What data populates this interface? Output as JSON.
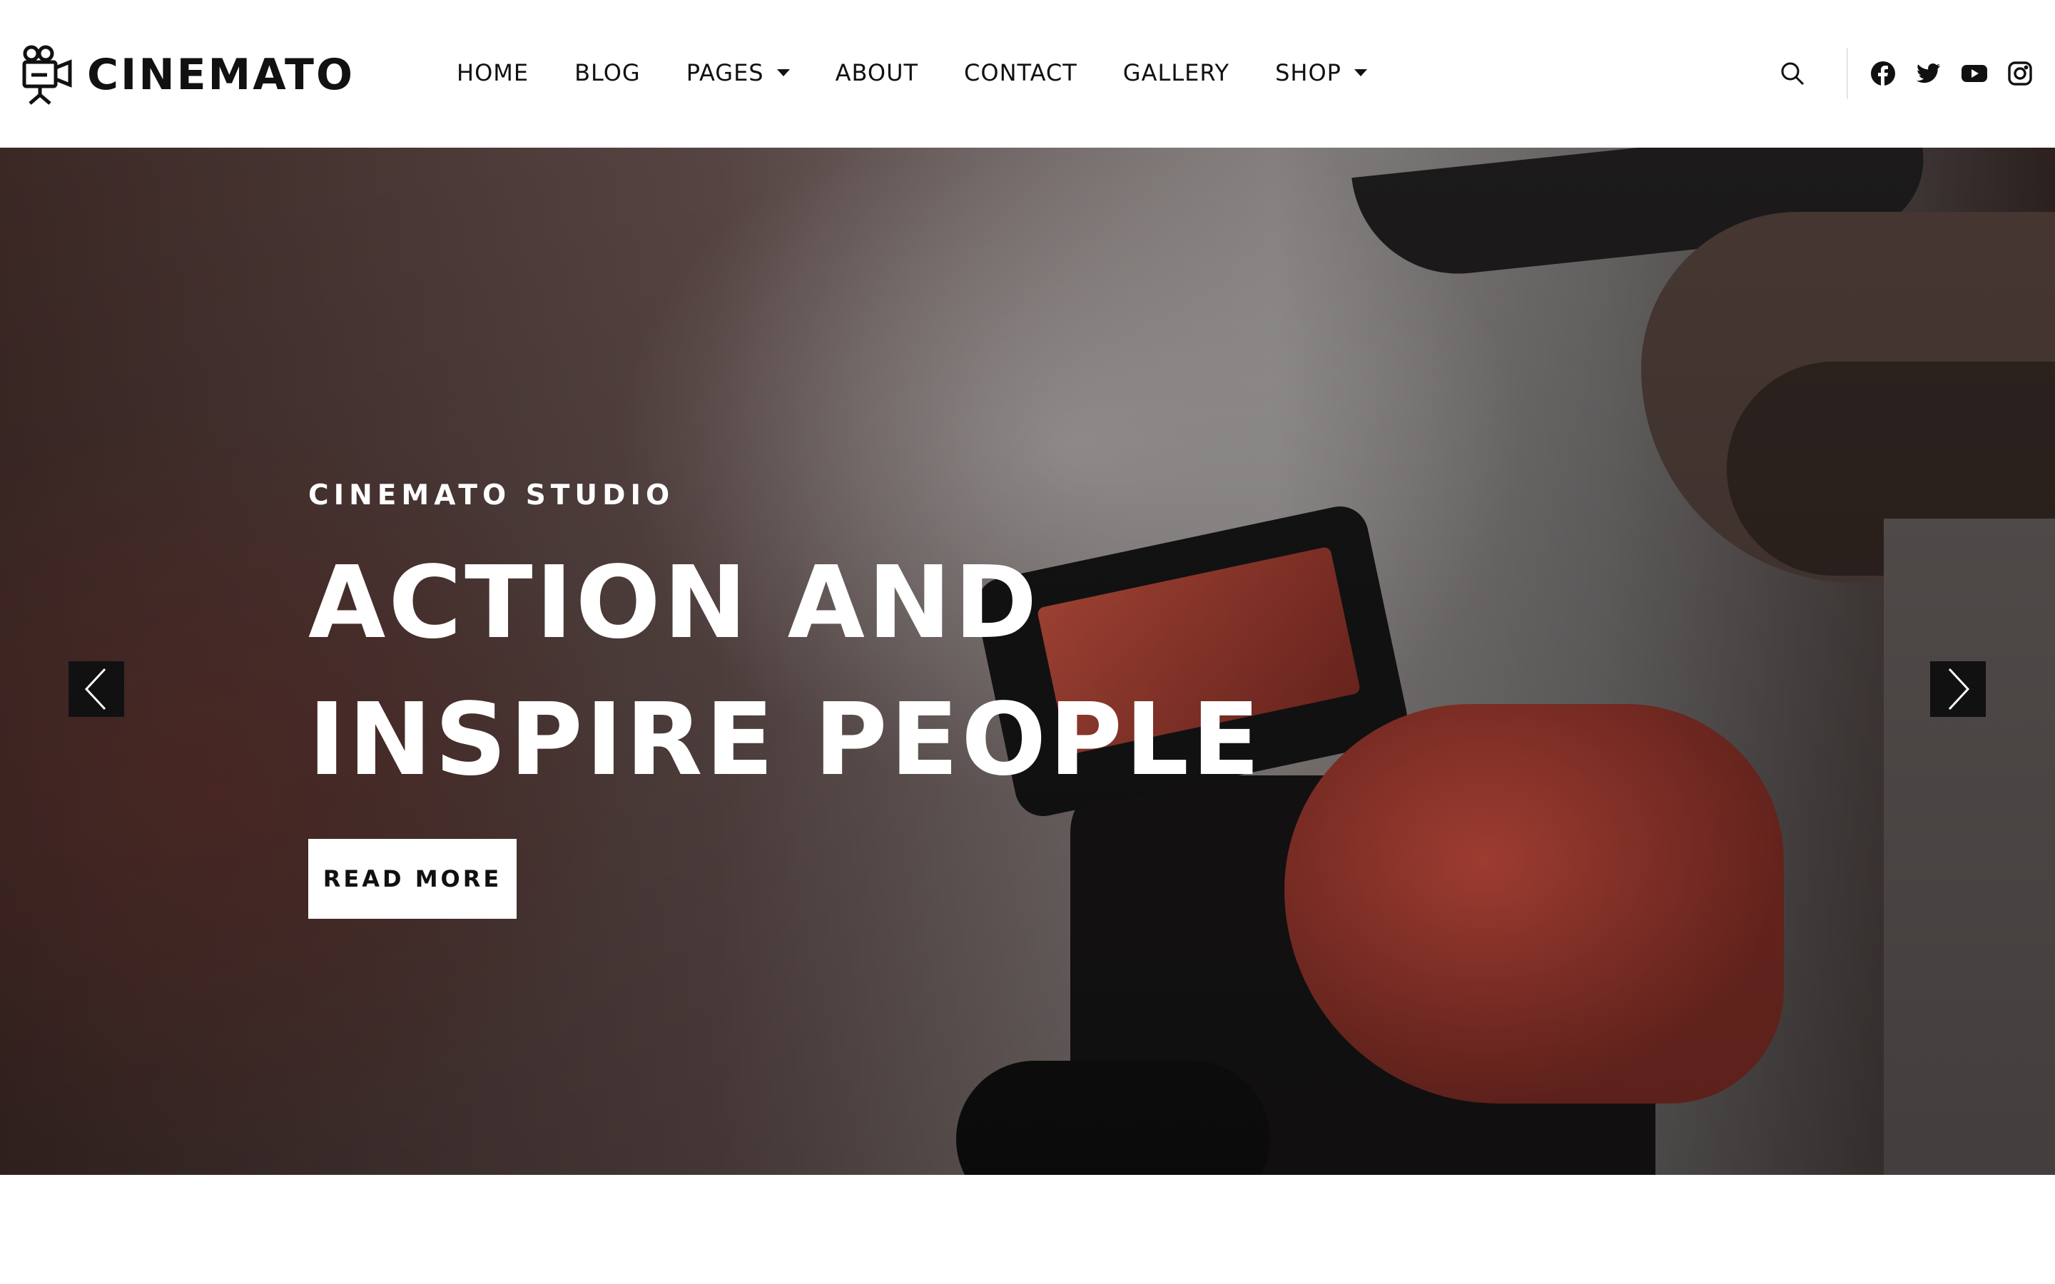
{
  "brand": {
    "name": "CINEMATO",
    "logo_icon": "film-camera-icon"
  },
  "nav": {
    "items": [
      {
        "label": "HOME",
        "dropdown": false
      },
      {
        "label": "BLOG",
        "dropdown": false
      },
      {
        "label": "PAGES",
        "dropdown": true
      },
      {
        "label": "ABOUT",
        "dropdown": false
      },
      {
        "label": "CONTACT",
        "dropdown": false
      },
      {
        "label": "GALLERY",
        "dropdown": false
      },
      {
        "label": "SHOP",
        "dropdown": true
      }
    ]
  },
  "header_actions": {
    "search_icon": "search-icon",
    "social": [
      "facebook-icon",
      "twitter-icon",
      "youtube-icon",
      "instagram-icon"
    ]
  },
  "hero": {
    "eyebrow": "CINEMATO STUDIO",
    "title_line_1": "ACTION AND",
    "title_line_2": "INSPIRE PEOPLE",
    "button_label": "READ MORE",
    "prev_icon": "chevron-left-icon",
    "next_icon": "chevron-right-icon"
  },
  "colors": {
    "text_dark": "#111111",
    "background": "#ffffff",
    "hero_text": "#ffffff",
    "arrow_bg": "#111111"
  }
}
